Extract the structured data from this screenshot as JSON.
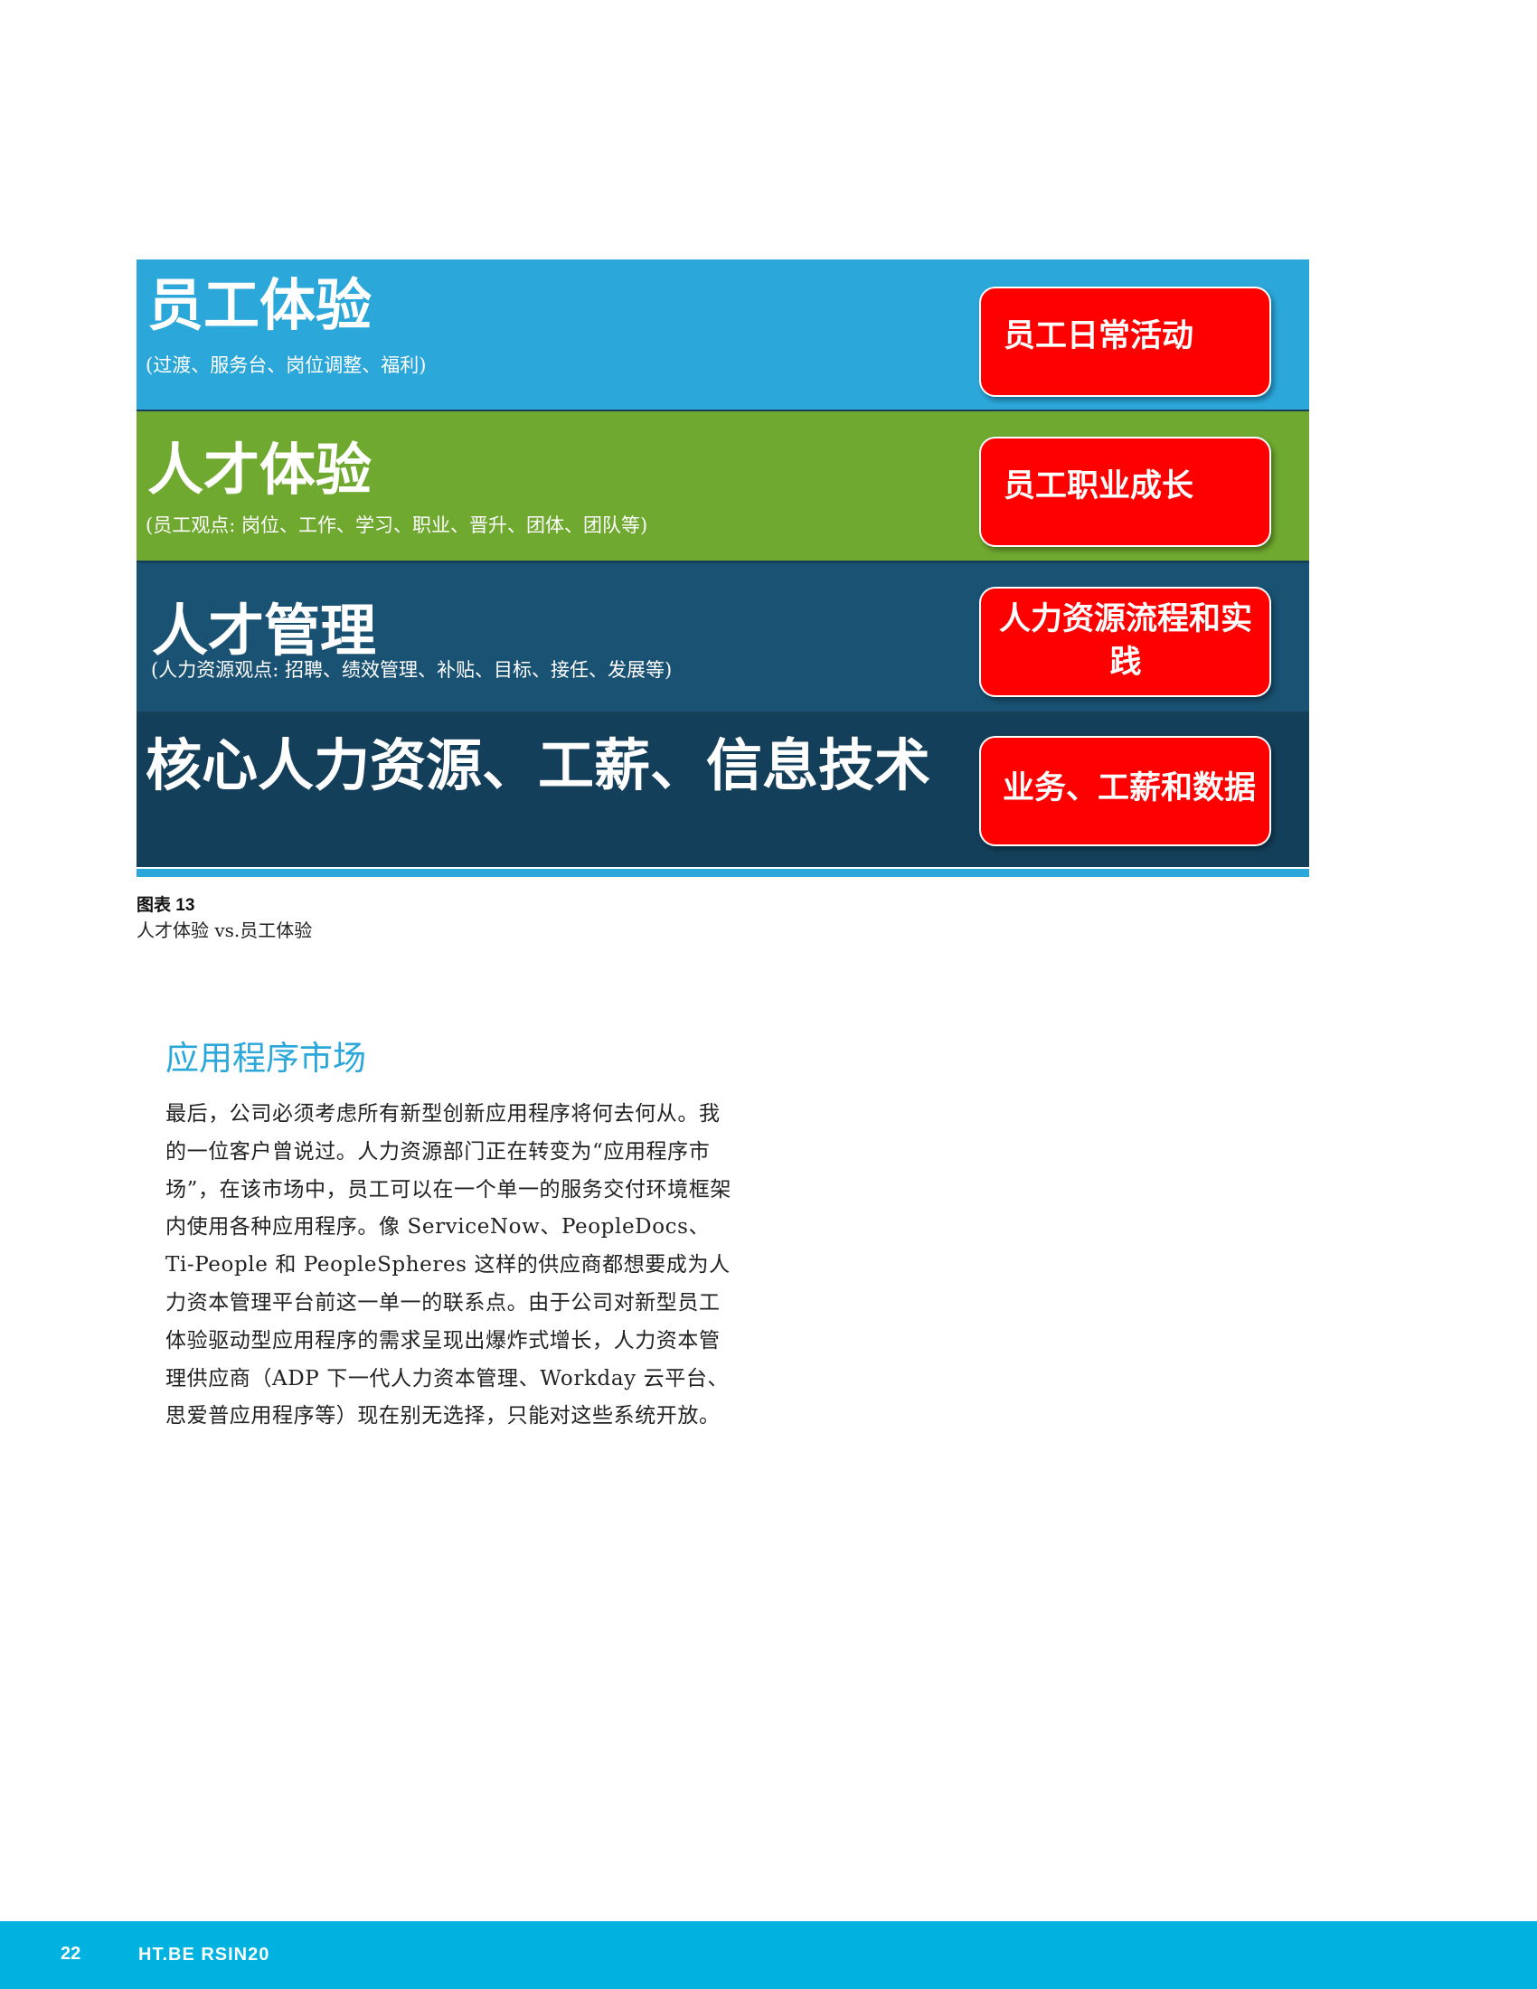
{
  "figure": {
    "bands": [
      {
        "title": "员工体验",
        "subtitle": "(过渡、服务台、岗位调整、福利)",
        "pill": "员工日常活动",
        "color": "#2ba7da"
      },
      {
        "title": "人才体验",
        "subtitle": "(员工观点: 岗位、工作、学习、职业、晋升、团体、团队等)",
        "pill": "员工职业成长",
        "color": "#6fa92f"
      },
      {
        "title": "人才管理",
        "subtitle": "(人力资源观点: 招聘、绩效管理、补贴、目标、接任、发展等)",
        "pill": "人力资源流程和实践",
        "color": "#1a5273"
      },
      {
        "title": "核心人力资源、工薪、信息技术",
        "pill": "业务、工薪和数据",
        "color": "#143f5a"
      }
    ],
    "pill_color": "#ff0000",
    "caption_label": "图表 13",
    "caption_text": "人才体验 vs.员工体验"
  },
  "section": {
    "heading": "应用程序市场",
    "body": "最后，公司必须考虑所有新型创新应用程序将何去何从。我的一位客户曾说过。人力资源部门正在转变为“应用程序市场”，在该市场中，员工可以在一个单一的服务交付环境框架内使用各种应用程序。像 ServiceNow、PeopleDocs、Ti-People 和 PeopleSpheres 这样的供应商都想要成为人力资本管理平台前这一单一的联系点。由于公司对新型员工体验驱动型应用程序的需求呈现出爆炸式增长，人力资本管理供应商（ADP 下一代人力资本管理、Workday 云平台、思爱普应用程序等）现在别无选择，只能对这些系统开放。"
  },
  "footer": {
    "page_number": "22",
    "brand": "HT.BE RSIN20",
    "color": "#00b2df"
  }
}
